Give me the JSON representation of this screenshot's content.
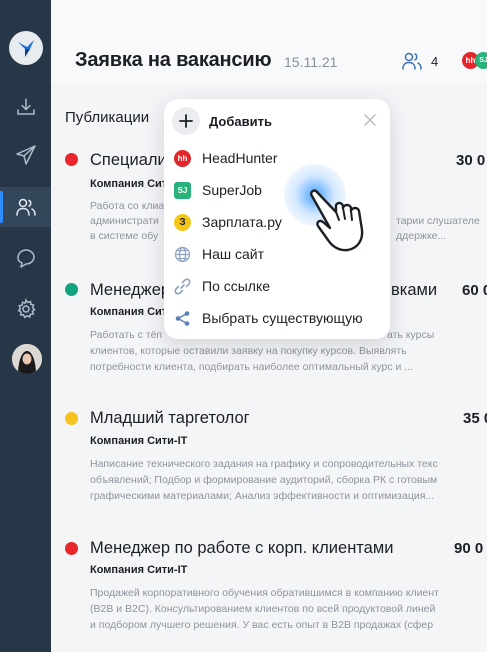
{
  "header": {
    "title": "Заявка на вакансию",
    "date": "15.11.21",
    "people_count": "4",
    "hh_badge": "hh",
    "sj_badge": "SJ"
  },
  "publications_label": "Публикации",
  "popup": {
    "add_label": "Добавить",
    "items": [
      {
        "label": "HeadHunter",
        "icon": "hh-logo-icon",
        "badge": "hh"
      },
      {
        "label": "SuperJob",
        "icon": "superjob-logo-icon",
        "badge": "SJ"
      },
      {
        "label": "Зарплата.ру",
        "icon": "zarplata-logo-icon",
        "badge": "З"
      },
      {
        "label": "Наш сайт",
        "icon": "globe-icon"
      },
      {
        "label": "По ссылке",
        "icon": "link-icon"
      },
      {
        "label": "Выбрать существующую",
        "icon": "share-icon"
      }
    ]
  },
  "vacancies": [
    {
      "title": "Специали",
      "salary": "30 0",
      "company": "Компания Сити",
      "status_color": "#e8262b",
      "desc": [
        "Работа со клиа",
        "администрати",
        "в системе обу"
      ],
      "desc_right": [
        "",
        "тарии слушателе",
        "ддержке..."
      ]
    },
    {
      "title": "Менеджер",
      "title_right": "вками",
      "salary": "60 0",
      "company": "Компания Сит",
      "status_color": "#14a37f",
      "desc": [
        "Работать с тёп",
        "клиентов, которые оставили заявку на покупку курсов. Выявлять",
        "потребности клиента, подбирать наиболее оптимальный курс и ..."
      ],
      "desc_first_right": "ать курсы"
    },
    {
      "title": "Младший таргетолог",
      "salary": "35 0",
      "company": "Компания Сити-IT",
      "status_color": "#f5c21b",
      "desc": [
        "Написание технического задания на графику и сопроводительных текс",
        "объявлений; Подбор и формирование аудиторий, сборка РК с готовым",
        "графическими материалами; Анализ эффективности и оптимизация..."
      ]
    },
    {
      "title": "Менеджер по работе с корп. клиентами",
      "salary": "90 0",
      "company": "Компания Сити-IT",
      "status_color": "#e8262b",
      "desc": [
        "Продажей корпоративного обучения обратившимся в компанию клиент",
        "(B2B и B2C). Консультированием клиентов по всей продуктовой линей",
        "и подбором лучшего решения. У вас есть опыт в В2В продажах (сфер"
      ]
    }
  ]
}
